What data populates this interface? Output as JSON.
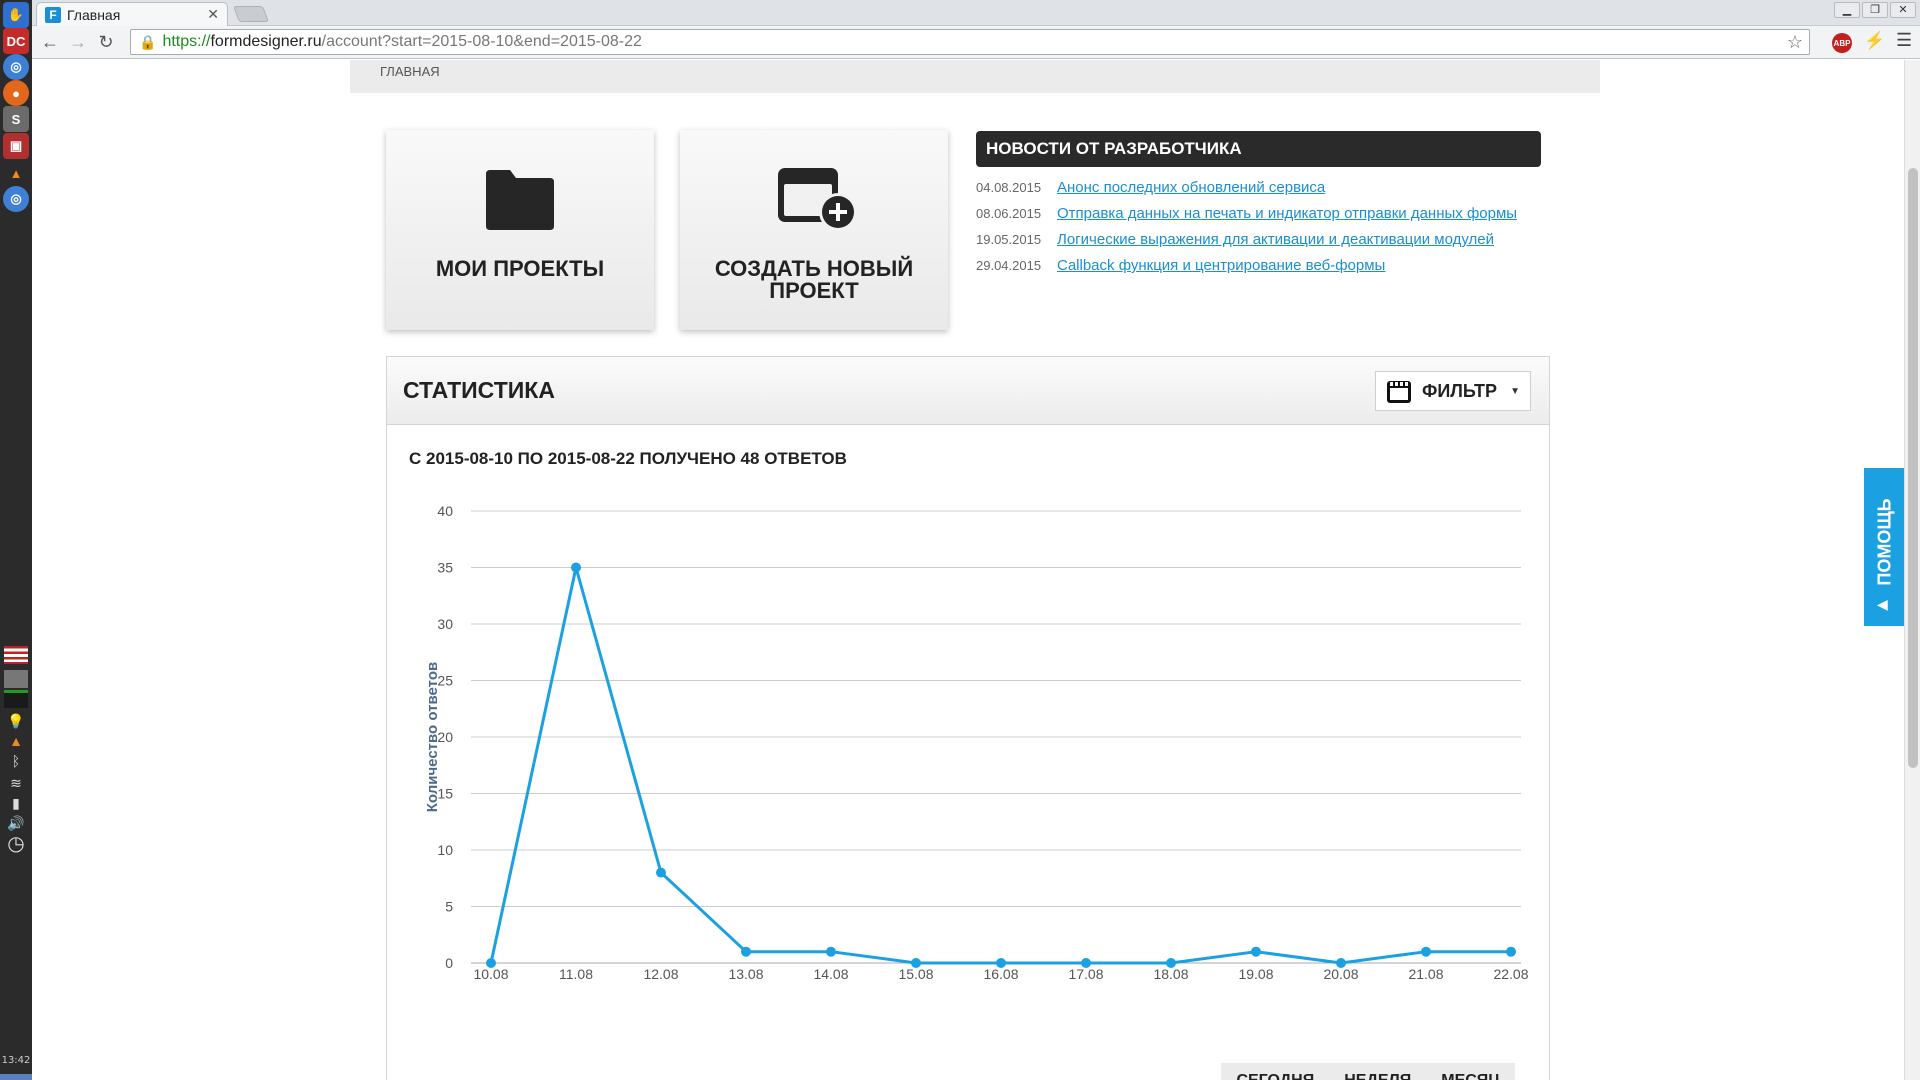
{
  "browser": {
    "tab_title": "Главная",
    "tab_favicon": "F",
    "close_glyph": "✕",
    "url_scheme": "https://",
    "url_host": "formdesigner.ru",
    "url_path": "/account?start=2015-08-10&end=2015-08-22",
    "abp_label": "ABP",
    "icons": [
      "back-icon",
      "forward-icon",
      "reload-icon",
      "lock-icon",
      "star-icon",
      "abp-icon",
      "bolt-icon",
      "menu-icon"
    ]
  },
  "dock": {
    "clock": "13:42",
    "icons": [
      "launcher-icon",
      "dc-icon",
      "chromium-icon",
      "firefox-icon",
      "sublime-icon",
      "installer-icon",
      "vlc-icon",
      "chromium-icon-2"
    ]
  },
  "page": {
    "breadcrumb": "ГЛАВНАЯ",
    "tiles": {
      "projects_label": "МОИ ПРОЕКТЫ",
      "create_label_line1": "СОЗДАТЬ НОВЫЙ",
      "create_label_line2": "ПРОЕКТ"
    },
    "news": {
      "header": "НОВОСТИ ОТ РАЗРАБОТЧИКА",
      "items": [
        {
          "date": "04.08.2015",
          "title": "Анонс последних обновлений сервиса"
        },
        {
          "date": "08.06.2015",
          "title": "Отправка данных на печать и индикатор отправки данных формы"
        },
        {
          "date": "19.05.2015",
          "title": "Логические выражения для активации и деактивации модулей"
        },
        {
          "date": "29.04.2015",
          "title": "Callback функция и центрирование веб-формы"
        }
      ]
    },
    "stats": {
      "title": "СТАТИСТИКА",
      "filter_label": "ФИЛЬТР",
      "summary": "С 2015-08-10 ПО 2015-08-22 ПОЛУЧЕНО 48 ОТВЕТОВ",
      "range_buttons": [
        "СЕГОДНЯ",
        "НЕДЕЛЯ",
        "МЕСЯЦ"
      ]
    },
    "help_label": "ПОМОЩЬ"
  },
  "colors": {
    "accent": "#1ba1e2",
    "line": "#1ba1e2",
    "link": "#1a8fd1",
    "news_header_bg": "#2a2a2a"
  },
  "chart_data": {
    "type": "line",
    "categories": [
      "10.08",
      "11.08",
      "12.08",
      "13.08",
      "14.08",
      "15.08",
      "16.08",
      "17.08",
      "18.08",
      "19.08",
      "20.08",
      "21.08",
      "22.08"
    ],
    "values": [
      0,
      35,
      8,
      1,
      1,
      0,
      0,
      0,
      0,
      1,
      0,
      1,
      1
    ],
    "ylabel": "Количество ответов",
    "ylim": [
      0,
      40
    ],
    "yticks": [
      0,
      5,
      10,
      15,
      20,
      25,
      30,
      35,
      40
    ],
    "grid": true
  }
}
